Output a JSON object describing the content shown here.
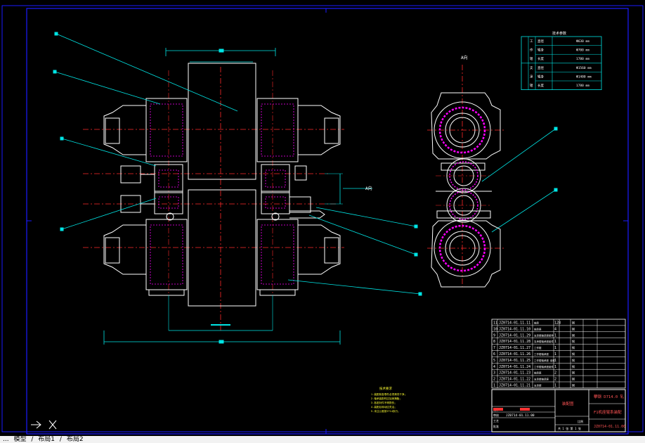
{
  "colors": {
    "background": "#000000",
    "frame": "#1a1aff",
    "outline": "#ffffff",
    "dimension": "#00e5e5",
    "center_line": "#ff2a2a",
    "accent": "#ff00ff",
    "hatch": "#c06080",
    "yellow": "#ffff33",
    "green": "#33ff33"
  },
  "view_label_a": "A向",
  "view_label_arrow": "A向",
  "spec_table": {
    "title": "技术参数",
    "rows": [
      {
        "group": "工",
        "label": "直径",
        "value": "Φ630 mm"
      },
      {
        "group": "作",
        "label": "辊身",
        "value": "Φ700 mm"
      },
      {
        "group": "辊",
        "label": "长度",
        "value": "1780 mm"
      },
      {
        "group": "支",
        "label": "直径",
        "value": "Φ1560 mm"
      },
      {
        "group": "承",
        "label": "辊身",
        "value": "Φ1400 mm"
      },
      {
        "group": "辊",
        "label": "长度",
        "value": "1780 mm"
      }
    ]
  },
  "parts_list": [
    {
      "no": "11",
      "code": "JZ0714-01.11.11",
      "name": "轴承",
      "qty": "128",
      "note": "钢"
    },
    {
      "no": "10",
      "code": "JZ0714-01.11.10",
      "name": "轴承座",
      "qty": "4",
      "note": "钢"
    },
    {
      "no": "9",
      "code": "JZ0714-01.11.29",
      "name": "支承辊轴承座组件",
      "qty": "1",
      "note": "钢"
    },
    {
      "no": "8",
      "code": "JZ0714-01.11.28",
      "name": "支承辊轴承座组件",
      "qty": "1",
      "note": "钢"
    },
    {
      "no": "7",
      "code": "JZ0714-01.11.27",
      "name": "工作辊",
      "qty": "1",
      "note": "钢"
    },
    {
      "no": "6",
      "code": "JZ0714-01.11.26",
      "name": "工作辊轴承座",
      "qty": "1",
      "note": "钢"
    },
    {
      "no": "5",
      "code": "JZ0714-01.11.25",
      "name": "工作辊轴承座 组件",
      "qty": "1",
      "note": "钢"
    },
    {
      "no": "4",
      "code": "JZ0714-01.11.24",
      "name": "工作辊轴承座组件",
      "qty": "1",
      "note": "钢"
    },
    {
      "no": "3",
      "code": "JZ0714-01.11.23",
      "name": "轴承座",
      "qty": "2",
      "note": "钢"
    },
    {
      "no": "2",
      "code": "JZ0714-01.11.22",
      "name": "支承辊轴承座",
      "qty": "2",
      "note": "钢"
    },
    {
      "no": "1",
      "code": "JZ0714-01.11.21",
      "name": "支承辊",
      "qty": "1",
      "note": "钢"
    }
  ],
  "title_block": {
    "school": "攀钢 D714.0 轧",
    "drawing_name": "F1机座辊系装配",
    "drawing_no": "JZ0714-01.11.00",
    "assembly_label": "装配图",
    "scale_label": "比例",
    "sheet_label": "共 1 张 第 1 张",
    "row_code": "JZ0714-01.11.00",
    "row_labels": [
      "设计",
      "审核",
      "工艺",
      "批准"
    ]
  },
  "notes": {
    "title": "技术要求",
    "lines": [
      "1.装配前各零件必须清洗干净；",
      "2.轴承装配时应加润滑脂；",
      "3.各密封件不得损伤；",
      "4.装配后转动应灵活；",
      "5.未注公差按IT14执行。"
    ]
  },
  "statusbar": {
    "items": [
      "模型",
      "布局1",
      "布局2"
    ],
    "prefix": "...",
    "separator": "/"
  }
}
